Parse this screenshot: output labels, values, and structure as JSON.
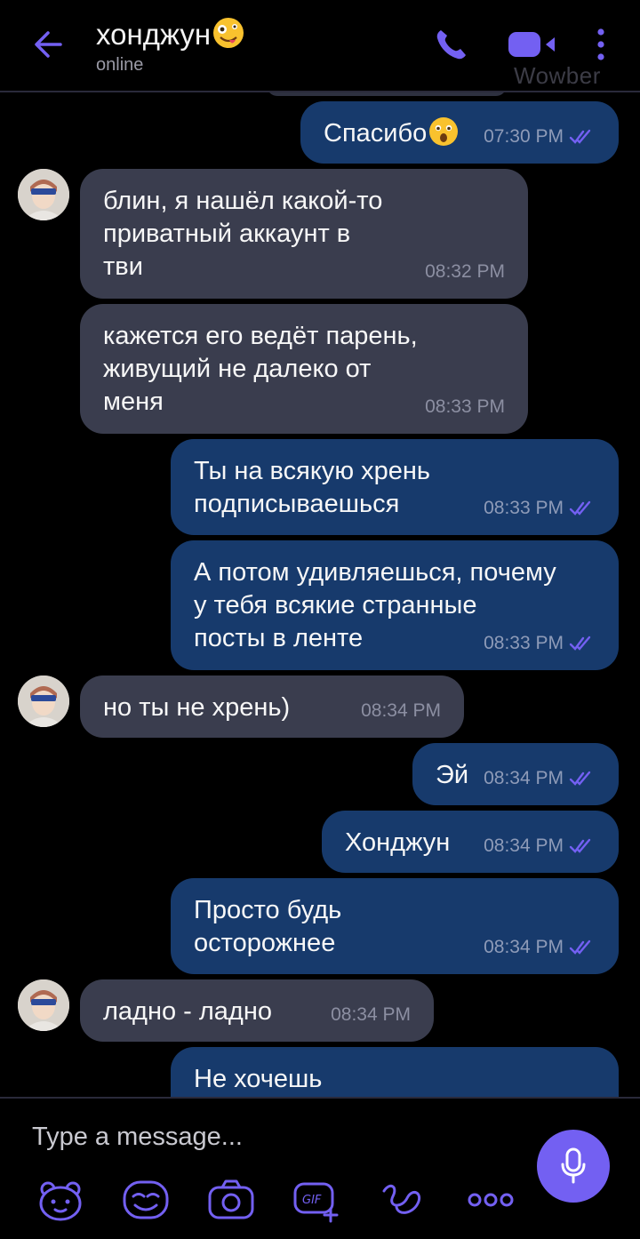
{
  "header": {
    "contact_name": "хонджун",
    "status": "online",
    "watermark": "Wowber",
    "accent_color": "#7360f2"
  },
  "messages": [
    {
      "direction": "out",
      "text_lines": [
        "Спасибо"
      ],
      "emoji": "astonished-face",
      "time": "07:30 PM",
      "read": true
    },
    {
      "direction": "in",
      "text_lines": [
        "блин, я нашёл какой-то",
        "приватный аккаунт в",
        "тви"
      ],
      "time": "08:32 PM",
      "avatar": true
    },
    {
      "direction": "in",
      "text_lines": [
        "кажется его ведёт парень,",
        "живущий не далеко от",
        "меня"
      ],
      "time": "08:33 PM",
      "avatar": false
    },
    {
      "direction": "out",
      "text_lines": [
        "Ты на всякую хрень",
        "подписываешься"
      ],
      "time": "08:33 PM",
      "read": true
    },
    {
      "direction": "out",
      "text_lines": [
        "А потом удивляешься, почему",
        "у тебя всякие странные",
        "посты в ленте"
      ],
      "time": "08:33 PM",
      "read": true
    },
    {
      "direction": "in",
      "text_lines": [
        "но ты не хрень)"
      ],
      "time": "08:34 PM",
      "avatar": true
    },
    {
      "direction": "out",
      "text_lines": [
        "Эй"
      ],
      "time": "08:34 PM",
      "read": true
    },
    {
      "direction": "out",
      "text_lines": [
        "Хонджун"
      ],
      "time": "08:34 PM",
      "read": true
    },
    {
      "direction": "out",
      "text_lines": [
        "Просто будь",
        "осторожнее"
      ],
      "time": "08:34 PM",
      "read": true
    },
    {
      "direction": "in",
      "text_lines": [
        "ладно - ладно"
      ],
      "time": "08:34 PM",
      "avatar": true
    },
    {
      "direction": "out",
      "text_lines": [
        "Не хочешь"
      ],
      "time": "",
      "read": false
    }
  ],
  "composer": {
    "placeholder": "Type a message...",
    "tools": [
      "sticker-icon",
      "emoji-icon",
      "camera-icon",
      "gif-icon",
      "doodle-icon",
      "more-icon"
    ]
  },
  "colors": {
    "incoming_bubble": "#3a3d4e",
    "outgoing_bubble": "#173a6c",
    "read_ticks": "#7360f2"
  }
}
